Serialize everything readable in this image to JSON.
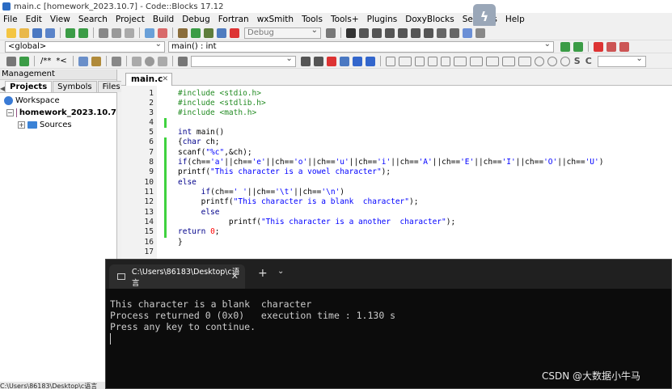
{
  "window": {
    "title": "main.c [homework_2023.10.7] - Code::Blocks 17.12"
  },
  "menu": [
    "File",
    "Edit",
    "View",
    "Search",
    "Project",
    "Build",
    "Debug",
    "Fortran",
    "wxSmith",
    "Tools",
    "Tools+",
    "Plugins",
    "DoxyBlocks",
    "Settings",
    "Help"
  ],
  "toolbar": {
    "build_target": "Debug",
    "scope": "<global>",
    "function": "main() : int"
  },
  "management": {
    "title": "Management",
    "tabs": [
      "Projects",
      "Symbols",
      "Files"
    ],
    "workspace": "Workspace",
    "project": "homework_2023.10.7",
    "folder": "Sources"
  },
  "editor": {
    "tab": "main.c",
    "line_numbers": [
      "1",
      "2",
      "3",
      "4",
      "5",
      "6",
      "7",
      "8",
      "9",
      "10",
      "11",
      "12",
      "13",
      "14",
      "15",
      "16",
      "17"
    ],
    "lines": [
      "#include <stdio.h>",
      "#include <stdlib.h>",
      "#include <math.h>",
      "",
      "int main()",
      "{char ch;",
      "scanf(\"%c\",&ch);",
      "if(ch=='a'||ch=='e'||ch=='o'||ch=='u'||ch=='i'||ch=='A'||ch=='E'||ch=='I'||ch=='O'||ch=='U')",
      "printf(\"This character is a vowel character\");",
      "else",
      "     if(ch==' '||ch=='\\t'||ch=='\\n')",
      "     printf(\"This character is a blank  character\");",
      "     else",
      "           printf(\"This character is a another  character\");",
      "return 0;",
      "}",
      ""
    ]
  },
  "terminal": {
    "tab_title": "C:\\Users\\86183\\Desktop\\c语言",
    "output": [
      "This character is a blank  character",
      "Process returned 0 (0x0)   execution time : 1.130 s",
      "Press any key to continue."
    ]
  },
  "statusbar": {
    "path": "C:\\Users\\86183\\Desktop\\c语言"
  },
  "watermark": "CSDN @大数据小牛马",
  "colors": {
    "keyword": "#00008b",
    "preprocessor": "#228b22",
    "string": "#0000ff",
    "number": "#ff0000",
    "change_bar": "#3fd23f",
    "terminal_bg": "#0c0c0c"
  }
}
